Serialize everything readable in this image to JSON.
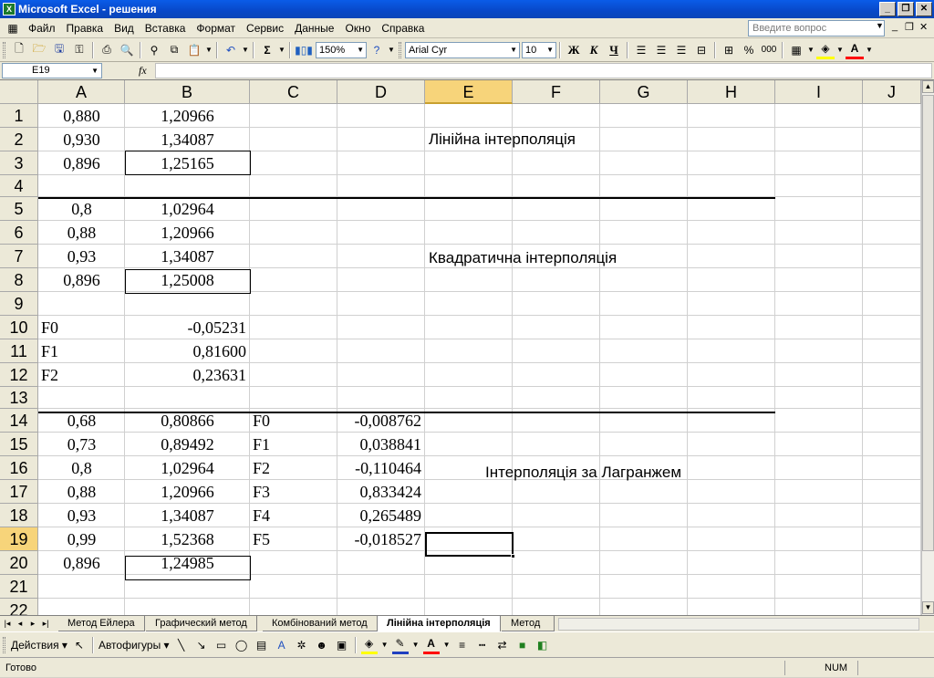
{
  "window": {
    "title": "Microsoft Excel - решения",
    "app_icon": "X"
  },
  "menu": {
    "items": [
      "Файл",
      "Правка",
      "Вид",
      "Вставка",
      "Формат",
      "Сервис",
      "Данные",
      "Окно",
      "Справка"
    ],
    "ask_placeholder": "Введите вопрос"
  },
  "toolbar": {
    "zoom": "150%",
    "font_name": "Arial Cyr",
    "font_size": "10",
    "bold": "Ж",
    "italic": "К",
    "underline": "Ч",
    "sum": "Σ",
    "percent": "%",
    "thousands": "000"
  },
  "formula_bar": {
    "name_box": "E19",
    "fx": "fx",
    "content": ""
  },
  "grid": {
    "columns": [
      "A",
      "B",
      "C",
      "D",
      "E",
      "F",
      "G",
      "H",
      "I",
      "J"
    ],
    "selected_column": "E",
    "rows": [
      "1",
      "2",
      "3",
      "4",
      "5",
      "6",
      "7",
      "8",
      "9",
      "10",
      "11",
      "12",
      "13",
      "14",
      "15",
      "16",
      "17",
      "18",
      "19",
      "20",
      "21",
      "22"
    ],
    "selected_row": "19"
  },
  "cells": {
    "A1": "0,880",
    "B1": "1,20966",
    "A2": "0,930",
    "B2": "1,34087",
    "A3": "0,896",
    "B3": "1,25165",
    "A5": "0,8",
    "B5": "1,02964",
    "A6": "0,88",
    "B6": "1,20966",
    "A7": "0,93",
    "B7": "1,34087",
    "A8": "0,896",
    "B8": "1,25008",
    "A10": "F0",
    "B10": "-0,05231",
    "A11": "F1",
    "B11": "0,81600",
    "A12": "F2",
    "B12": "0,23631",
    "A14": "0,68",
    "B14": "0,80866",
    "C14": "F0",
    "D14": "-0,008762",
    "A15": "0,73",
    "B15": "0,89492",
    "C15": "F1",
    "D15": "0,038841",
    "A16": "0,8",
    "B16": "1,02964",
    "C16": "F2",
    "D16": "-0,110464",
    "A17": "0,88",
    "B17": "1,20966",
    "C17": "F3",
    "D17": "0,833424",
    "A18": "0,93",
    "B18": "1,34087",
    "C18": "F4",
    "D18": "0,265489",
    "A19": "0,99",
    "B19": "1,52368",
    "C19": "F5",
    "D19": "-0,018527",
    "A20": "0,896",
    "B20": "1,24985"
  },
  "notes": {
    "linear": "Лінійна інтерполяція",
    "quadratic": "Квадратична інтерполяція",
    "lagrange": "Інтерполяція за Лагранжем"
  },
  "tabs": {
    "items": [
      "Метод Ейлера",
      "Графический метод",
      "Комбінований метод",
      "Лінійна інтерполяція",
      "Метод Га"
    ],
    "active": "Лінійна інтерполяція"
  },
  "drawing_toolbar": {
    "actions": "Действия",
    "autoshapes": "Автофигуры"
  },
  "status": {
    "text": "Готово",
    "num": "NUM"
  }
}
